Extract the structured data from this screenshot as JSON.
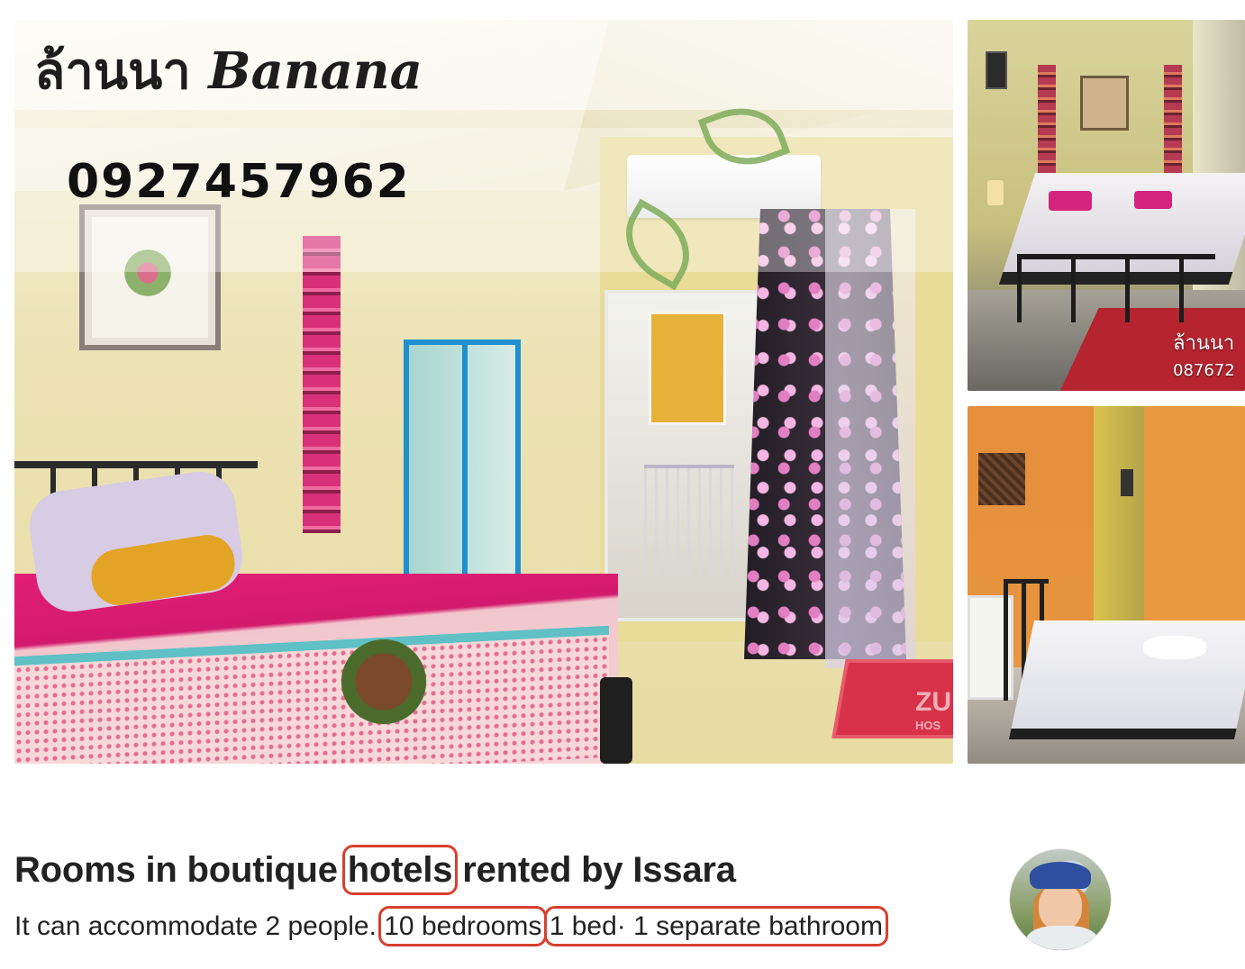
{
  "gallery": {
    "main_photo": {
      "overlay_title_thai": "ล้านนา",
      "overlay_title_latin": "Banana",
      "overlay_phone": "0927457962",
      "watermark": "ZU",
      "watermark_sub": "HOS"
    },
    "top_right_photo": {
      "caption_thai": "ล้านนา",
      "caption_phone": "087672"
    },
    "bottom_right_photo": {}
  },
  "listing": {
    "title_part1": "Rooms in boutique ",
    "title_highlight": "hotels",
    "title_part2": " rented by Issara",
    "subtitle_part1": "It can accommodate 2 people. ",
    "subtitle_bedrooms": "10 bedrooms",
    "subtitle_beds_bath": "1 bed· 1 separate bathroom"
  },
  "colors": {
    "highlight_border": "#d8402d",
    "text": "#222222"
  }
}
